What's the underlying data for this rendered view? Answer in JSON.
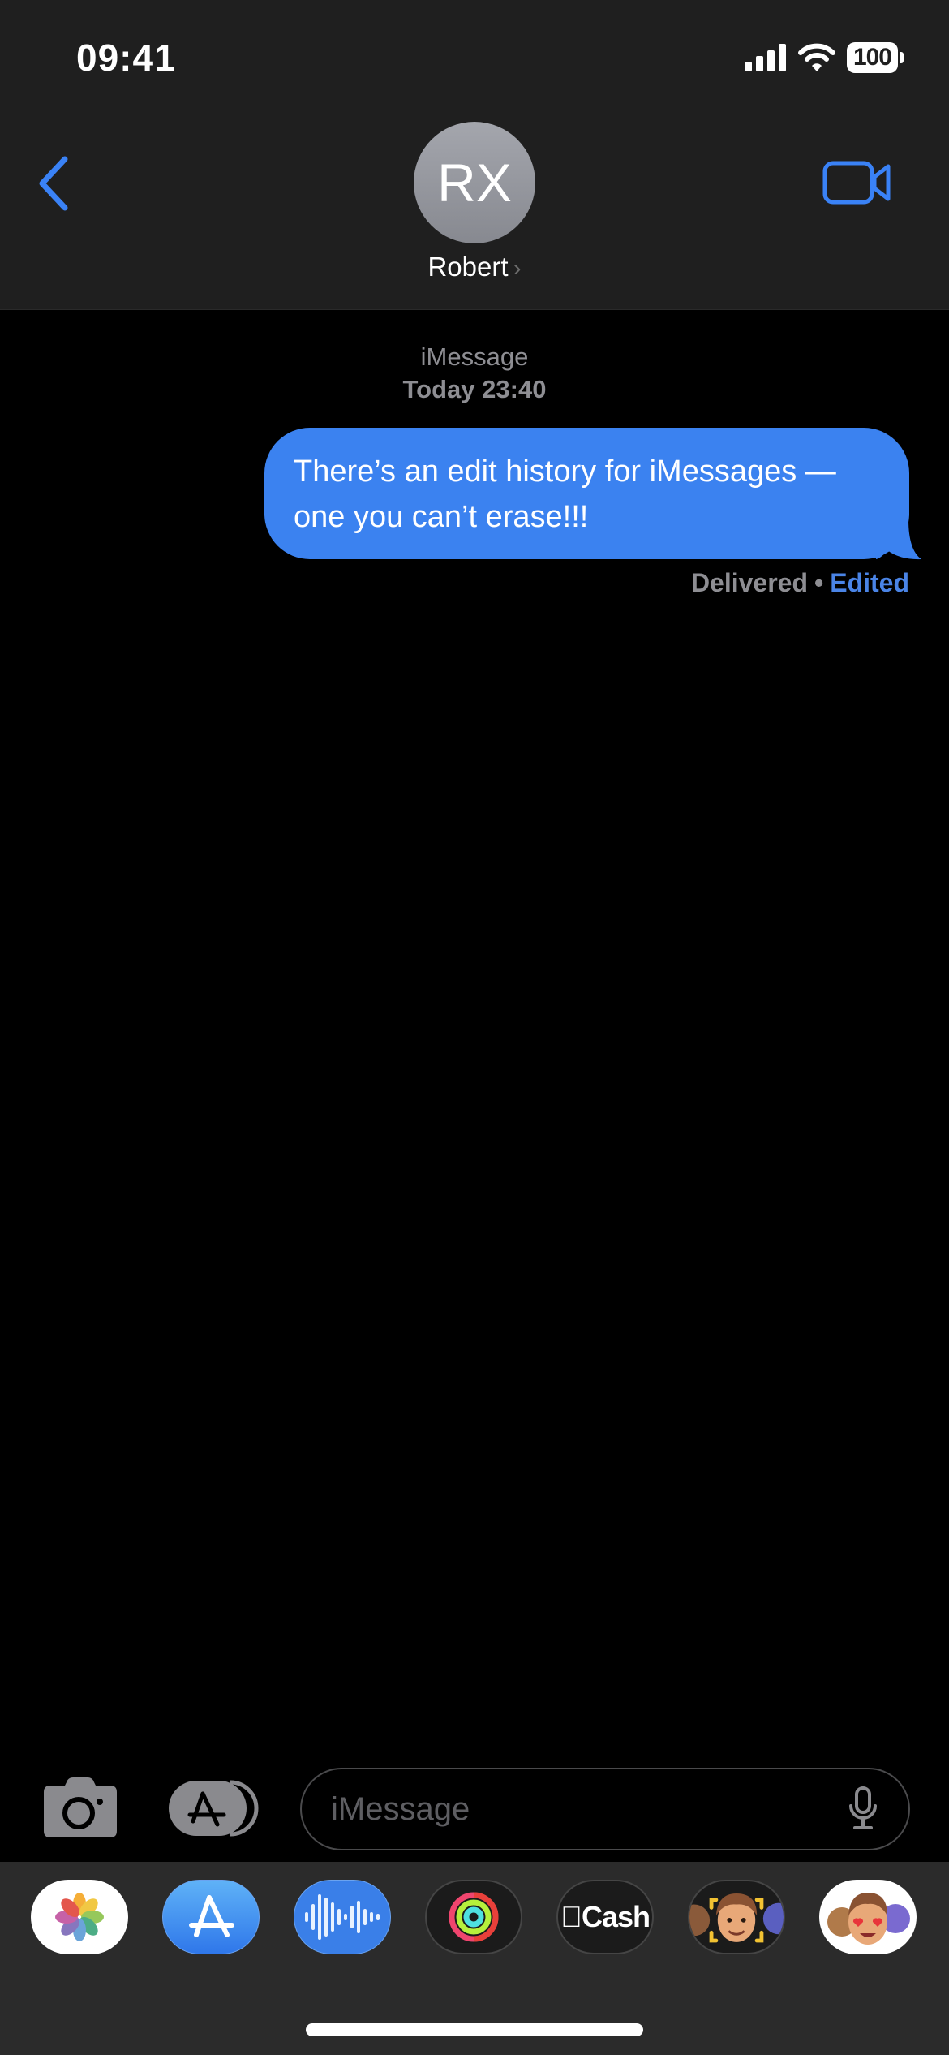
{
  "status_bar": {
    "time": "09:41",
    "battery": "100"
  },
  "header": {
    "avatar_initials": "RX",
    "contact_name": "Robert",
    "contact_chevron": "›",
    "colors": {
      "accent": "#3a82f6",
      "avatar_bg": "#979aa1"
    }
  },
  "conversation": {
    "service_label": "iMessage",
    "timestamp": "Today 23:40",
    "messages": [
      {
        "direction": "outgoing",
        "text": "There’s an edit history for iMessages — one you can’t erase!!!",
        "status": "Delivered",
        "separator": "•",
        "edited_label": "Edited",
        "bubble_color": "#3b82f0"
      }
    ]
  },
  "composer": {
    "placeholder": "iMessage",
    "value": ""
  },
  "app_drawer": {
    "apps": [
      {
        "name": "Photos",
        "icon": "photos-icon"
      },
      {
        "name": "App Store",
        "icon": "app-store-icon"
      },
      {
        "name": "Audio Message",
        "icon": "audio-waveform-icon"
      },
      {
        "name": "Fitness",
        "icon": "activity-rings-icon"
      },
      {
        "name": "Apple Cash",
        "icon": "apple-cash-icon",
        "label": "Cash"
      },
      {
        "name": "Memoji",
        "icon": "memoji-icon"
      },
      {
        "name": "Memoji Stickers",
        "icon": "memoji-stickers-icon"
      }
    ]
  }
}
